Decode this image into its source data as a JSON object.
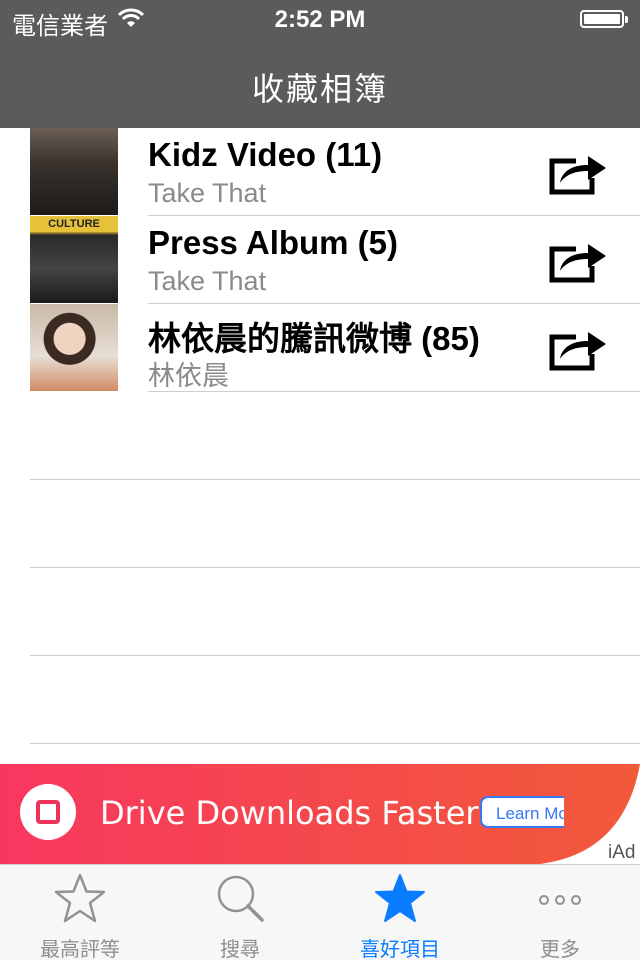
{
  "status_bar": {
    "carrier": "電信業者",
    "time": "2:52 PM"
  },
  "nav": {
    "title": "收藏相簿"
  },
  "albums": [
    {
      "title": "Kidz Video (11)",
      "subtitle": "Take That"
    },
    {
      "title": "Press Album (5)",
      "subtitle": "Take That",
      "thumb_text": "CULTURE"
    },
    {
      "title": "林依晨的騰訊微博 (85)",
      "subtitle": "林依晨"
    }
  ],
  "ad": {
    "headline": "Drive Downloads Faster",
    "button": "Learn Mo",
    "badge": "iAd"
  },
  "tabs": [
    {
      "label": "最高評等",
      "icon": "star-outline-icon"
    },
    {
      "label": "搜尋",
      "icon": "search-icon"
    },
    {
      "label": "喜好項目",
      "icon": "star-filled-icon",
      "active": true
    },
    {
      "label": "更多",
      "icon": "more-dots-icon"
    }
  ],
  "colors": {
    "accent": "#0a7cff",
    "nav_bg": "#5b5b5b",
    "ad_gradient_start": "#f8375f",
    "ad_gradient_end": "#f25a3a"
  }
}
